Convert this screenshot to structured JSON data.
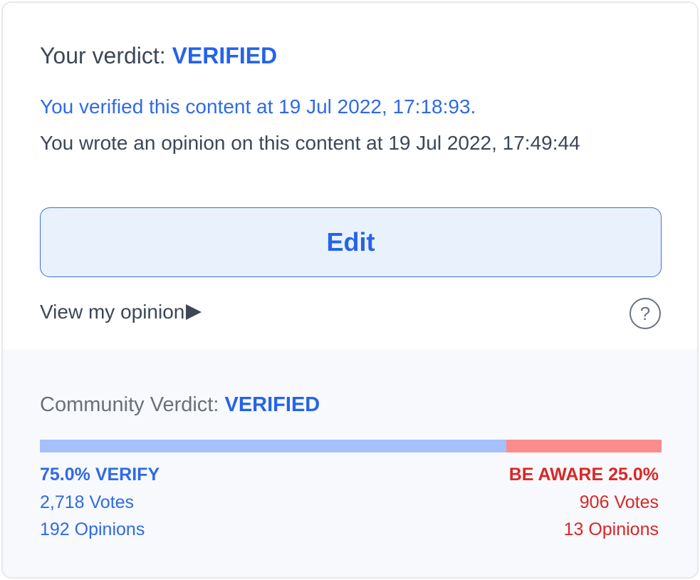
{
  "my_verdict": {
    "label": "Your verdict: ",
    "value": "VERIFIED",
    "verified_text": "You verified this content at 19 Jul 2022, 17:18:93.",
    "opinion_text": "You wrote an opinion on this content at 19 Jul 2022, 17:49:44"
  },
  "actions": {
    "edit_label": "Edit",
    "view_opinion_label": "View my opinion",
    "help_symbol": "?"
  },
  "community": {
    "label": "Community Verdict: ",
    "value": "VERIFIED",
    "verify_fraction": 0.75,
    "verify": {
      "headline": "75.0% VERIFY",
      "votes": "2,718 Votes",
      "opinions": "192 Opinions"
    },
    "aware": {
      "headline": "BE AWARE 25.0%",
      "votes": "906 Votes",
      "opinions": "13 Opinions"
    }
  },
  "colors": {
    "accent": "#2563eb",
    "verify_bar": "#a6c0fb",
    "aware_bar": "#fc8c8c",
    "aware_text": "#dc2626"
  },
  "icons": {
    "view_opinion": "play-triangle-icon",
    "help": "question-circle-icon"
  }
}
